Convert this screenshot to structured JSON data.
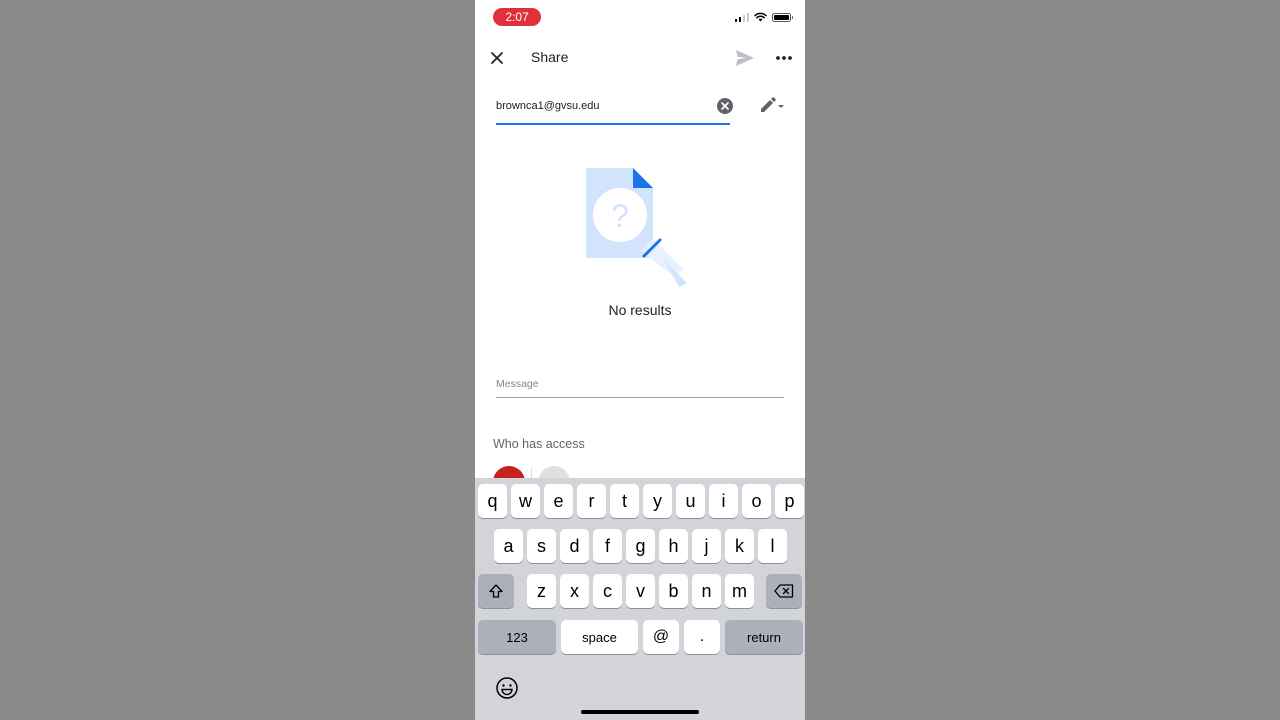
{
  "status_bar": {
    "time": "2:07"
  },
  "header": {
    "title": "Share"
  },
  "share_form": {
    "email_value": "brownca1@gvsu.edu",
    "no_results": "No results",
    "message_placeholder": "Message",
    "who_has_access": "Who has access"
  },
  "keyboard": {
    "row1": [
      "q",
      "w",
      "e",
      "r",
      "t",
      "y",
      "u",
      "i",
      "o",
      "p"
    ],
    "row2": [
      "a",
      "s",
      "d",
      "f",
      "g",
      "h",
      "j",
      "k",
      "l"
    ],
    "row3": [
      "z",
      "x",
      "c",
      "v",
      "b",
      "n",
      "m"
    ],
    "numbers": "123",
    "space": "space",
    "at": "@",
    "dot": ".",
    "return": "return"
  },
  "colors": {
    "accent": "#1a73e8",
    "time_pill": "#e0303a",
    "owner_avatar": "#c5221f",
    "keyboard_bg": "#d2d4d9"
  }
}
